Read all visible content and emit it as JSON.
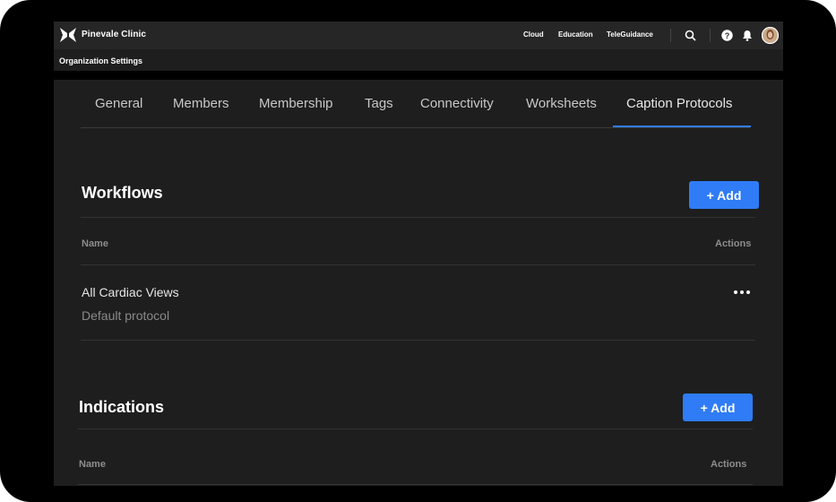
{
  "app": {
    "brand": "Pinevale Clinic",
    "nav": [
      "Cloud",
      "Education",
      "TeleGuidance"
    ],
    "icons": [
      "search-icon",
      "help-icon",
      "bell-icon",
      "avatar"
    ]
  },
  "page_title": "Organization Settings",
  "tabs": [
    "General",
    "Members",
    "Membership",
    "Tags",
    "Connectivity",
    "Worksheets",
    "Caption Protocols"
  ],
  "active_tab": "Caption Protocols",
  "workflows": {
    "title": "Workflows",
    "add_label": "+ Add",
    "col_name": "Name",
    "col_actions": "Actions",
    "rows": [
      {
        "name": "All Cardiac Views",
        "subtitle": "Default protocol",
        "actions_icon": "more-icon"
      }
    ]
  },
  "indications": {
    "title": "Indications",
    "add_label": "+ Add",
    "col_name": "Name",
    "col_actions": "Actions"
  },
  "colors": {
    "accent": "#2f7cf6",
    "background": "#1e1e1e",
    "topbar": "#262626"
  }
}
